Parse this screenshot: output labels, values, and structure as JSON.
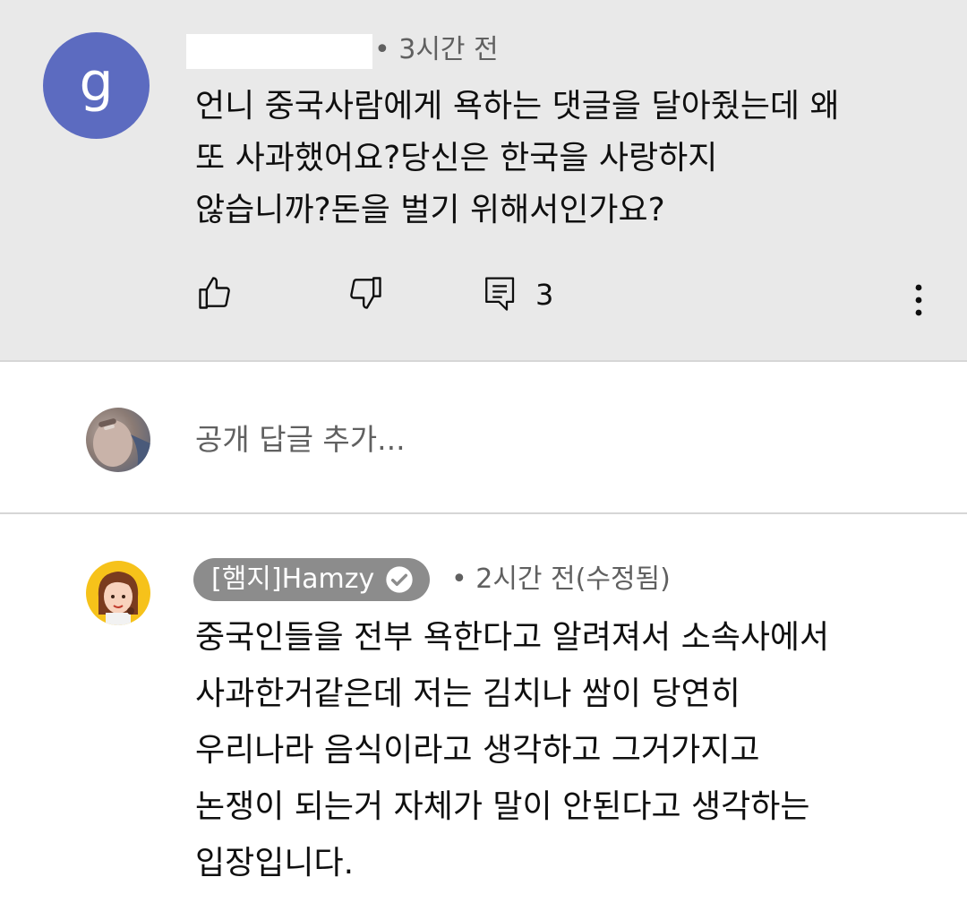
{
  "comment1": {
    "avatar_letter": "g",
    "avatar_color": "#5c6bc0",
    "meta": "• 3시간 전",
    "body_lines": [
      "언니 중국사람에게 욕하는 댓글을 달아줬는데 왜",
      "또 사과했어요?당신은 한국을 사랑하지",
      "않습니까?돈을 벌기 위해서인가요?"
    ],
    "reply_count": "3",
    "icons": {
      "like": "thumbs-up-icon",
      "dislike": "thumbs-down-icon",
      "reply": "comment-icon",
      "more": "more-vert-icon"
    }
  },
  "reply_box": {
    "placeholder": "공개 답글 추가..."
  },
  "comment2": {
    "author": "[햄지]Hamzy",
    "verified_icon": "verified-check-icon",
    "meta": "• 2시간 전(수정됨)",
    "body_lines": [
      "중국인들을 전부 욕한다고 알려져서 소속사에서",
      "사과한거같은데 저는 김치나 쌈이 당연히",
      "우리나라 음식이라고 생각하고 그거가지고",
      "논쟁이 되는거 자체가 말이 안된다고 생각하는",
      "입장입니다."
    ]
  }
}
